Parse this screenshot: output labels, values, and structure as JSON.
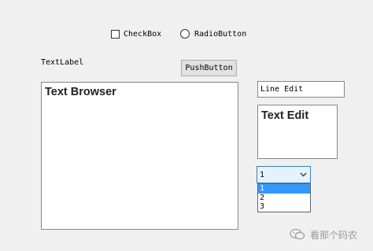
{
  "checkbox": {
    "label": "CheckBox",
    "checked": false
  },
  "radio": {
    "label": "RadioButton",
    "checked": false
  },
  "text_label": "TextLabel",
  "push_button": {
    "label": "PushButton"
  },
  "text_browser": {
    "content": "Text Browser"
  },
  "line_edit": {
    "value": "Line Edit"
  },
  "text_edit": {
    "content": "Text Edit"
  },
  "combo_box": {
    "selected": "1",
    "options": [
      "1",
      "2",
      "3"
    ],
    "highlighted_index": 0
  },
  "watermark": {
    "text": "看那个码农",
    "icon": "wechat-icon"
  },
  "colors": {
    "background": "#f0f0f0",
    "selection": "#3399ff",
    "combo_focus_border": "#3c7fb1"
  }
}
